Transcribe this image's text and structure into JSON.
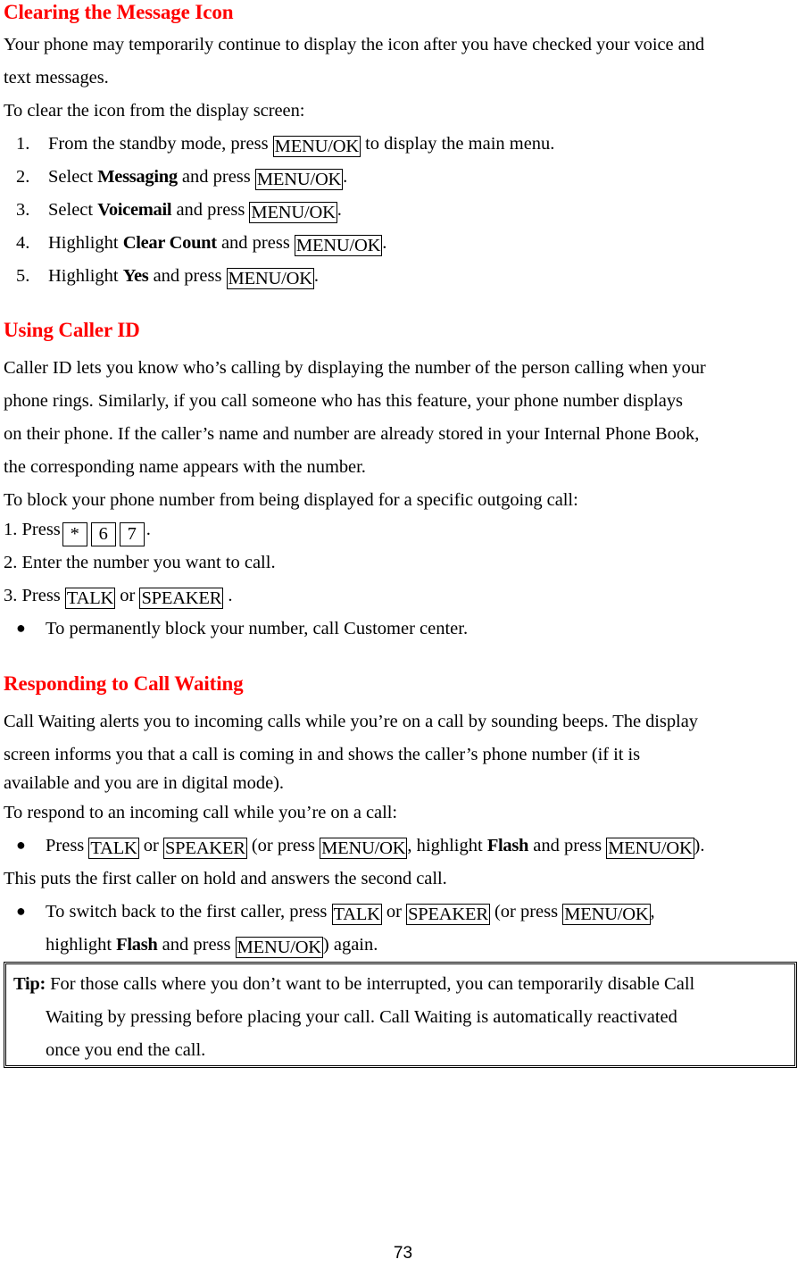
{
  "document": {
    "page_number": "73",
    "heading_color": "#ff0000",
    "text_color": "#000000"
  },
  "section1": {
    "heading": "Clearing the Message Icon",
    "intro_line1": "Your phone may temporarily continue to display the icon after you have checked your voice and",
    "intro_line2": "text messages.",
    "lead_in": "To clear the icon from the display screen:",
    "steps": [
      {
        "number": "1.",
        "text_before": "From the standby mode, press ",
        "key": "MENU/OK",
        "text_after": " to display the main menu."
      },
      {
        "number": "2.",
        "text_before": "Select ",
        "bold_term": "Messaging",
        "text_mid": " and press ",
        "key": "MENU/OK",
        "text_after": "."
      },
      {
        "number": "3.",
        "text_before": "Select ",
        "bold_term": "Voicemail",
        "text_mid": " and press ",
        "key": "MENU/OK",
        "text_after": "."
      },
      {
        "number": "4.",
        "text_before": "Highlight ",
        "bold_term": "Clear Count",
        "text_mid": " and press ",
        "key": "MENU/OK",
        "text_after": "."
      },
      {
        "number": "5.",
        "text_before": "Highlight ",
        "bold_term": "Yes",
        "text_mid": " and press ",
        "key": "MENU/OK",
        "text_after": "."
      }
    ]
  },
  "section2": {
    "heading": "Using Caller ID",
    "para_line1": "Caller ID lets you know who’s calling by displaying the number of the person calling when your",
    "para_line2": "phone rings. Similarly, if you call someone who has this feature, your phone number displays",
    "para_line3": "on their phone. If the caller’s name and number are already stored in your Internal Phone Book,",
    "para_line4": "the corresponding name appears with the number.",
    "lead_in": "To block your phone number from being displayed for a specific outgoing call:",
    "step1": {
      "number": "1.",
      "text_before": "Press",
      "key_star": "*",
      "key_six": "6",
      "key_seven": "7",
      "text_after": "."
    },
    "step2": {
      "number": "2.",
      "text": "Enter the number you want to call."
    },
    "step3": {
      "number": "3.",
      "text_before": "Press ",
      "key_talk": "TALK",
      "text_mid": " or ",
      "key_speaker": "SPEAKER",
      "text_after": " ."
    },
    "bullet1": {
      "marker": "●",
      "text": "To permanently block your number, call Customer center."
    }
  },
  "section3": {
    "heading": "Responding to Call Waiting",
    "para_line1": "Call Waiting alerts you to incoming calls while you’re on a call by sounding beeps. The display",
    "para_line2": "screen informs you that a call is coming in and shows the caller’s phone number (if it is",
    "para_line3": "available and you are in digital mode).",
    "lead_in": "To respond to an incoming call while you’re on a call:",
    "bullet1": {
      "marker": "●",
      "t1": "Press ",
      "key_talk": "TALK",
      "t2": " or ",
      "key_speaker": "SPEAKER",
      "t3": " (or press ",
      "key_menu1": "MENU/OK",
      "t4": ", highlight ",
      "bold_flash": "Flash",
      "t5": " and press ",
      "key_menu2": "MENU/OK",
      "t6": ")."
    },
    "after_bullet1": "This puts the first caller on hold and answers the second call.",
    "bullet2": {
      "marker": "●",
      "t1": "To switch back to the first caller, press ",
      "key_talk": "TALK",
      "t2": " or ",
      "key_speaker": "SPEAKER",
      "t3": " (or press ",
      "key_menu1": "MENU/OK",
      "t4": ",",
      "t5": "highlight ",
      "bold_flash": "Flash",
      "t6": " and press ",
      "key_menu2": "MENU/OK",
      "t7": ") again."
    }
  },
  "tip": {
    "label": "Tip:",
    "line1": " For those calls where you don’t want to be interrupted, you can temporarily disable Call",
    "line2": "Waiting by pressing before placing your call. Call Waiting is automatically reactivated",
    "line3": "once you end the call."
  }
}
